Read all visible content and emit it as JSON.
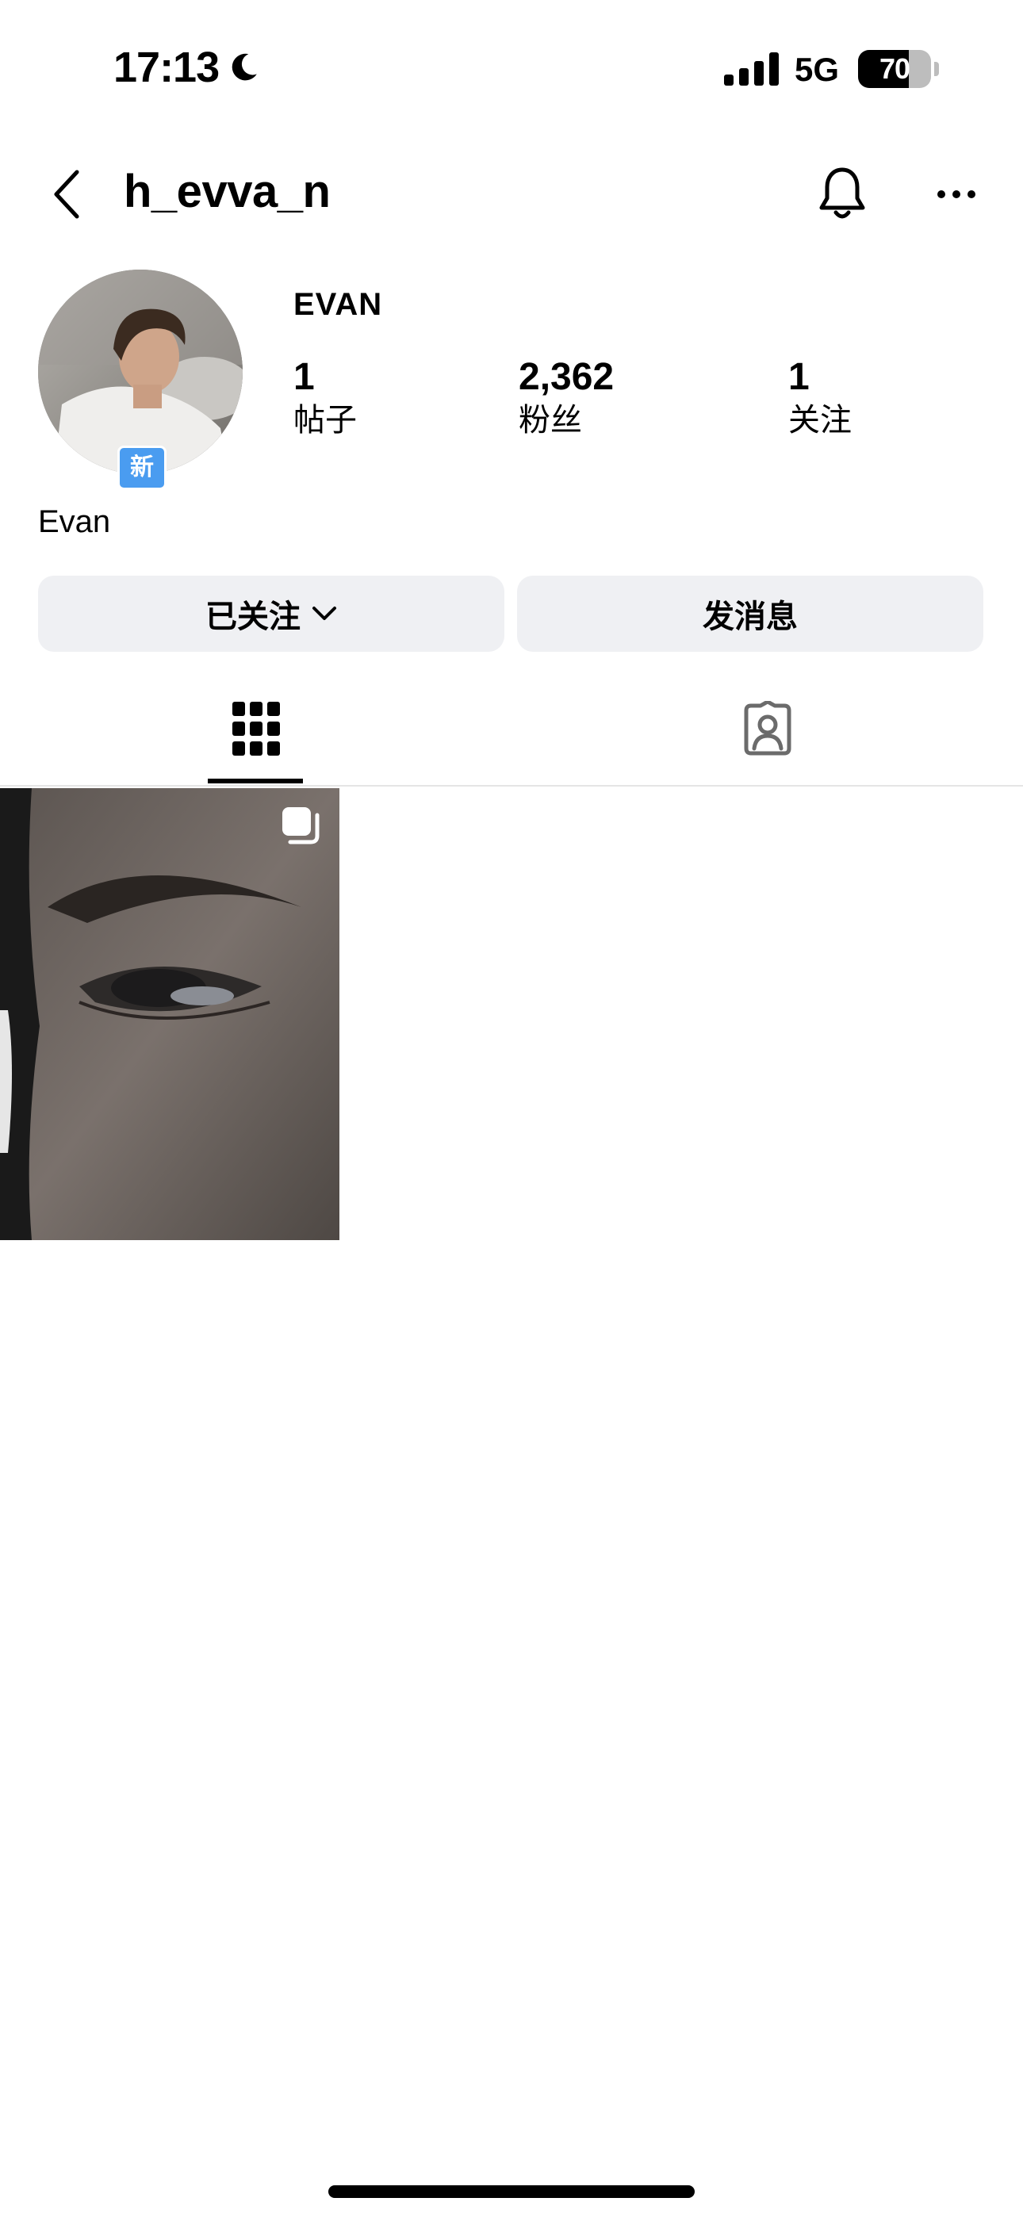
{
  "status_bar": {
    "time": "17:13",
    "network": "5G",
    "battery": "70",
    "battery_level": 0.7
  },
  "header": {
    "username": "h_evva_n"
  },
  "profile": {
    "display_name": "EVAN",
    "new_badge": "新",
    "bio_name": "Evan",
    "stats": [
      {
        "value": "1",
        "label": "帖子"
      },
      {
        "value": "2,362",
        "label": "粉丝"
      },
      {
        "value": "1",
        "label": "关注"
      }
    ]
  },
  "actions": {
    "following_label": "已关注",
    "message_label": "发消息"
  },
  "tabs": [
    {
      "icon": "grid-icon",
      "active": true
    },
    {
      "icon": "tagged-person-icon",
      "active": false
    }
  ],
  "posts": [
    {
      "icon": "multiple-posts-icon"
    }
  ]
}
